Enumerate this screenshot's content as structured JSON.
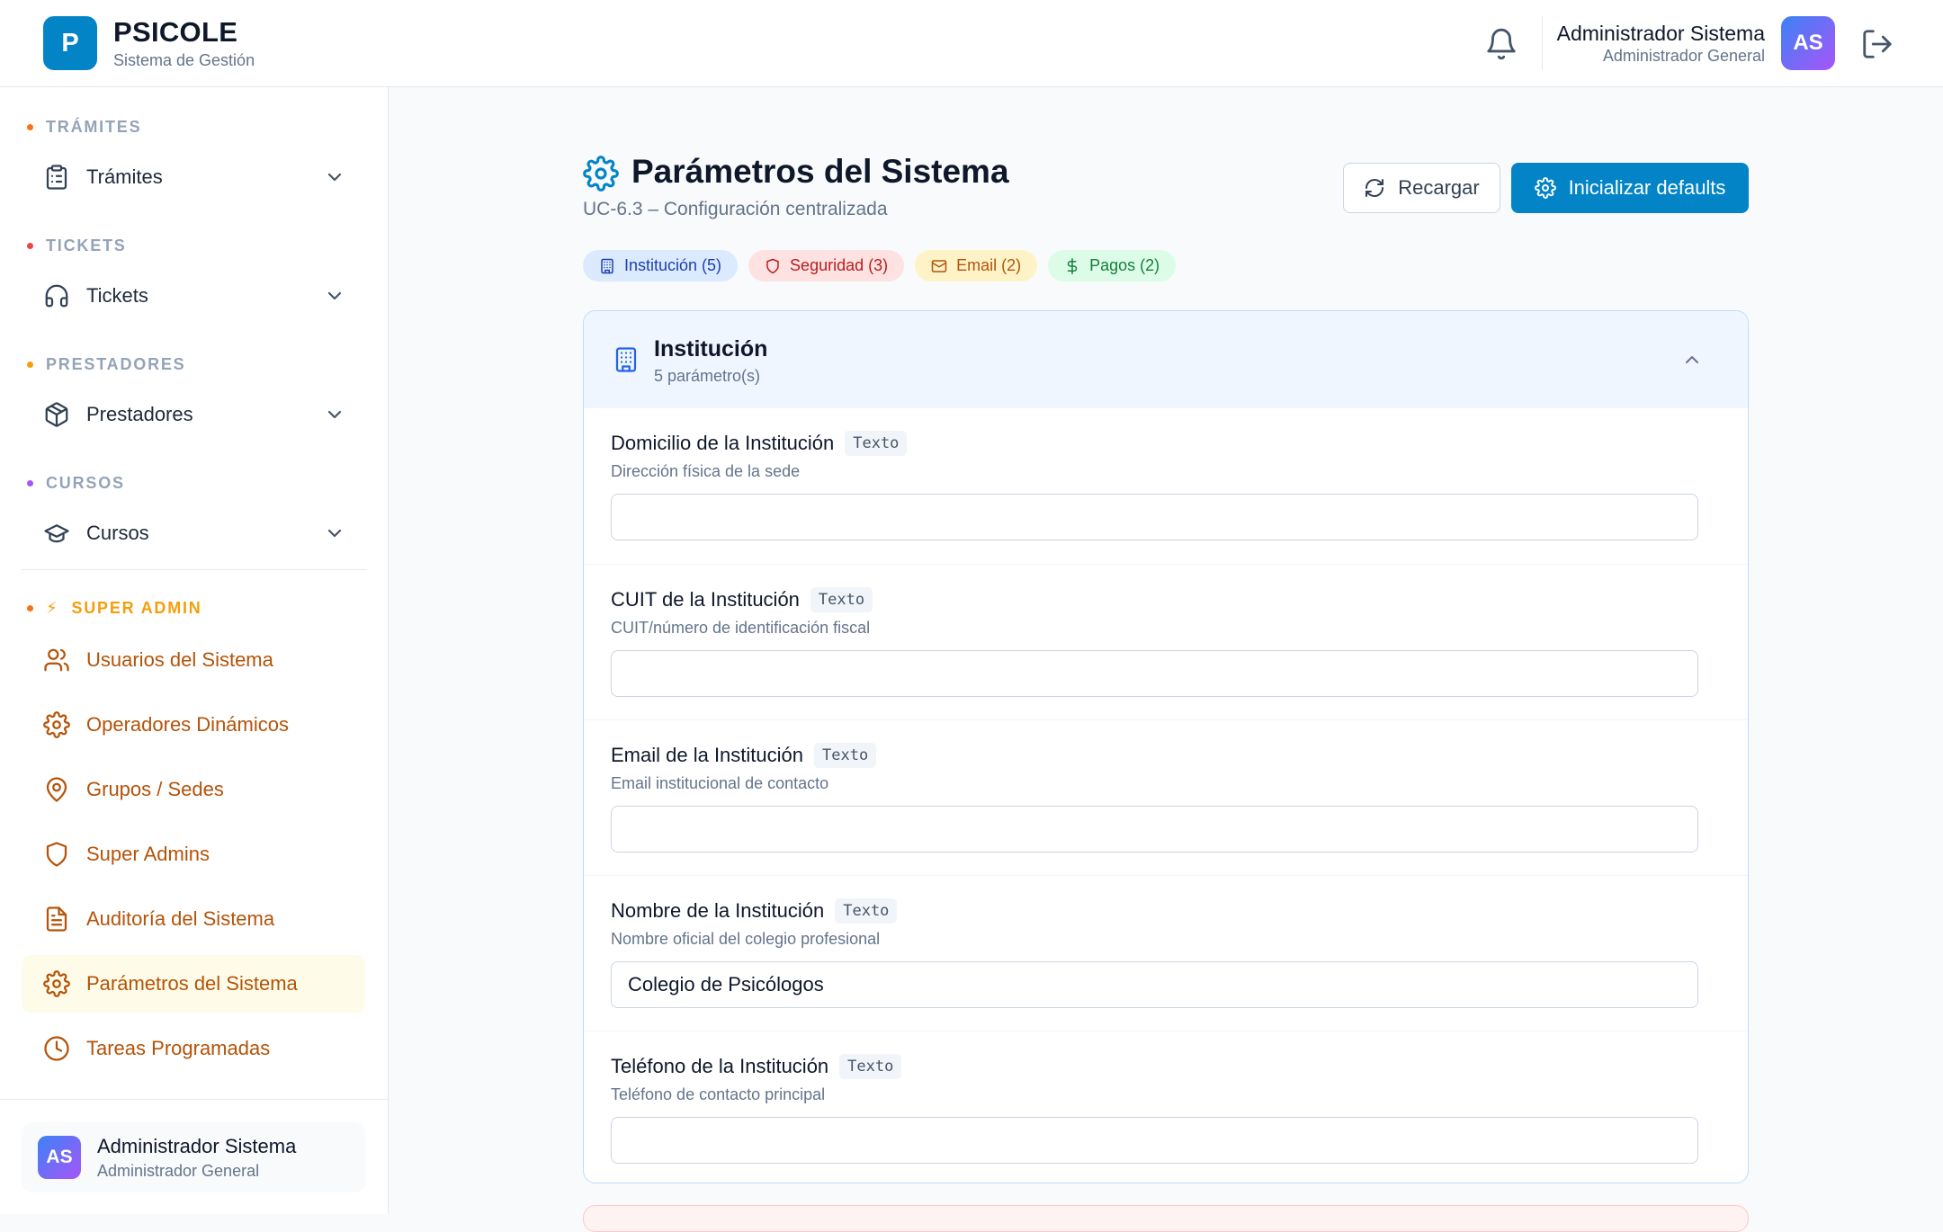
{
  "header": {
    "logo_letter": "P",
    "brand_name": "PSICOLE",
    "brand_sub": "Sistema de Gestión",
    "user_name": "Administrador Sistema",
    "user_role": "Administrador General",
    "avatar_initials": "AS"
  },
  "sidebar": {
    "sections": [
      {
        "title": "TRÁMITES",
        "dot_color": "#f97316",
        "item": "Trámites",
        "icon": "clipboard-icon"
      },
      {
        "title": "TICKETS",
        "dot_color": "#ef4444",
        "item": "Tickets",
        "icon": "headphones-icon"
      },
      {
        "title": "PRESTADORES",
        "dot_color": "#f59e0b",
        "item": "Prestadores",
        "icon": "package-icon"
      },
      {
        "title": "CURSOS",
        "dot_color": "#a855f7",
        "item": "Cursos",
        "icon": "graduation-cap-icon"
      }
    ],
    "super_admin": {
      "title": "SUPER ADMIN",
      "dot_color": "#f97316",
      "accent_color": "#b45309",
      "items": [
        {
          "label": "Usuarios del Sistema",
          "icon": "users-icon"
        },
        {
          "label": "Operadores Dinámicos",
          "icon": "gear-icon"
        },
        {
          "label": "Grupos / Sedes",
          "icon": "map-pin-icon"
        },
        {
          "label": "Super Admins",
          "icon": "shield-icon"
        },
        {
          "label": "Auditoría del Sistema",
          "icon": "file-text-icon"
        },
        {
          "label": "Parámetros del Sistema",
          "icon": "gear-icon",
          "active": true
        },
        {
          "label": "Tareas Programadas",
          "icon": "clock-icon"
        }
      ]
    },
    "footer": {
      "avatar_initials": "AS",
      "user_name": "Administrador Sistema",
      "user_role": "Administrador General"
    }
  },
  "main": {
    "title": "Parámetros del Sistema",
    "subtitle": "UC-6.3 – Configuración centralizada",
    "reload_label": "Recargar",
    "init_label": "Inicializar defaults",
    "primary_color": "#0284c7",
    "chips": [
      {
        "label": "Institución (5)",
        "icon": "building-icon",
        "bg": "#dbeafe",
        "fg": "#1e40af"
      },
      {
        "label": "Seguridad (3)",
        "icon": "shield-icon",
        "bg": "#fee2e2",
        "fg": "#b91c1c"
      },
      {
        "label": "Email (2)",
        "icon": "mail-icon",
        "bg": "#fef3c7",
        "fg": "#b45309"
      },
      {
        "label": "Pagos (2)",
        "icon": "dollar-icon",
        "bg": "#dcfce7",
        "fg": "#15803d"
      }
    ],
    "group": {
      "title": "Institución",
      "count": "5 parámetro(s)",
      "params": [
        {
          "label": "Domicilio de la Institución",
          "type": "Texto",
          "description": "Dirección física de la sede",
          "value": ""
        },
        {
          "label": "CUIT de la Institución",
          "type": "Texto",
          "description": "CUIT/número de identificación fiscal",
          "value": ""
        },
        {
          "label": "Email de la Institución",
          "type": "Texto",
          "description": "Email institucional de contacto",
          "value": ""
        },
        {
          "label": "Nombre de la Institución",
          "type": "Texto",
          "description": "Nombre oficial del colegio profesional",
          "value": "Colegio de Psicólogos"
        },
        {
          "label": "Teléfono de la Institución",
          "type": "Texto",
          "description": "Teléfono de contacto principal",
          "value": ""
        }
      ]
    }
  }
}
